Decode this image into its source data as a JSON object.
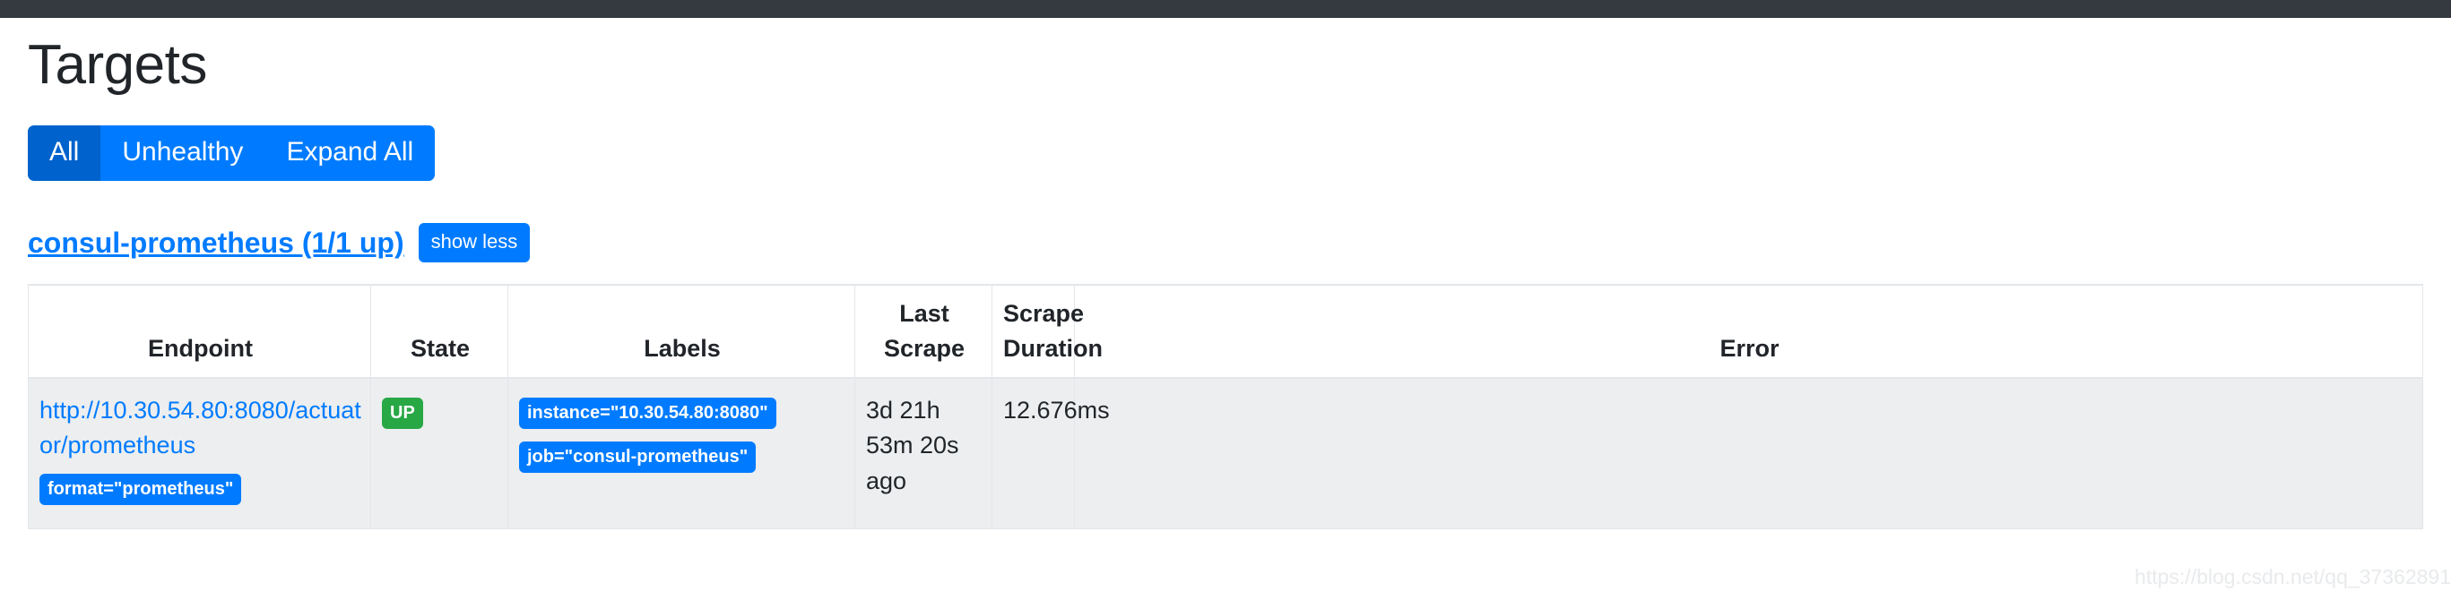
{
  "navbar": {
    "label": ""
  },
  "page": {
    "title": "Targets"
  },
  "filters": {
    "all_label": "All",
    "unhealthy_label": "Unhealthy",
    "expand_all_label": "Expand All"
  },
  "job": {
    "title": "consul-prometheus (1/1 up)",
    "toggle_label": "show less"
  },
  "table": {
    "headers": {
      "endpoint": "Endpoint",
      "state": "State",
      "labels": "Labels",
      "last_scrape": "Last Scrape",
      "scrape_duration": "Scrape Duration",
      "error": "Error"
    },
    "rows": [
      {
        "endpoint": "http://10.30.54.80:8080/actuator/prometheus",
        "endpoint_extra_label": "format=\"prometheus\"",
        "state": "UP",
        "labels": [
          "instance=\"10.30.54.80:8080\"",
          "job=\"consul-prometheus\""
        ],
        "last_scrape": "3d 21h 53m 20s ago",
        "scrape_duration": "12.676ms",
        "error": ""
      }
    ]
  },
  "watermark": {
    "text": "https://blog.csdn.net/qq_37362891"
  },
  "colors": {
    "navbar": "#343a40",
    "primary": "#007bff",
    "primary_active": "#0062cc",
    "success": "#28a745",
    "row_bg": "#eceeef",
    "border": "#e3e6ea",
    "text": "#212529"
  }
}
